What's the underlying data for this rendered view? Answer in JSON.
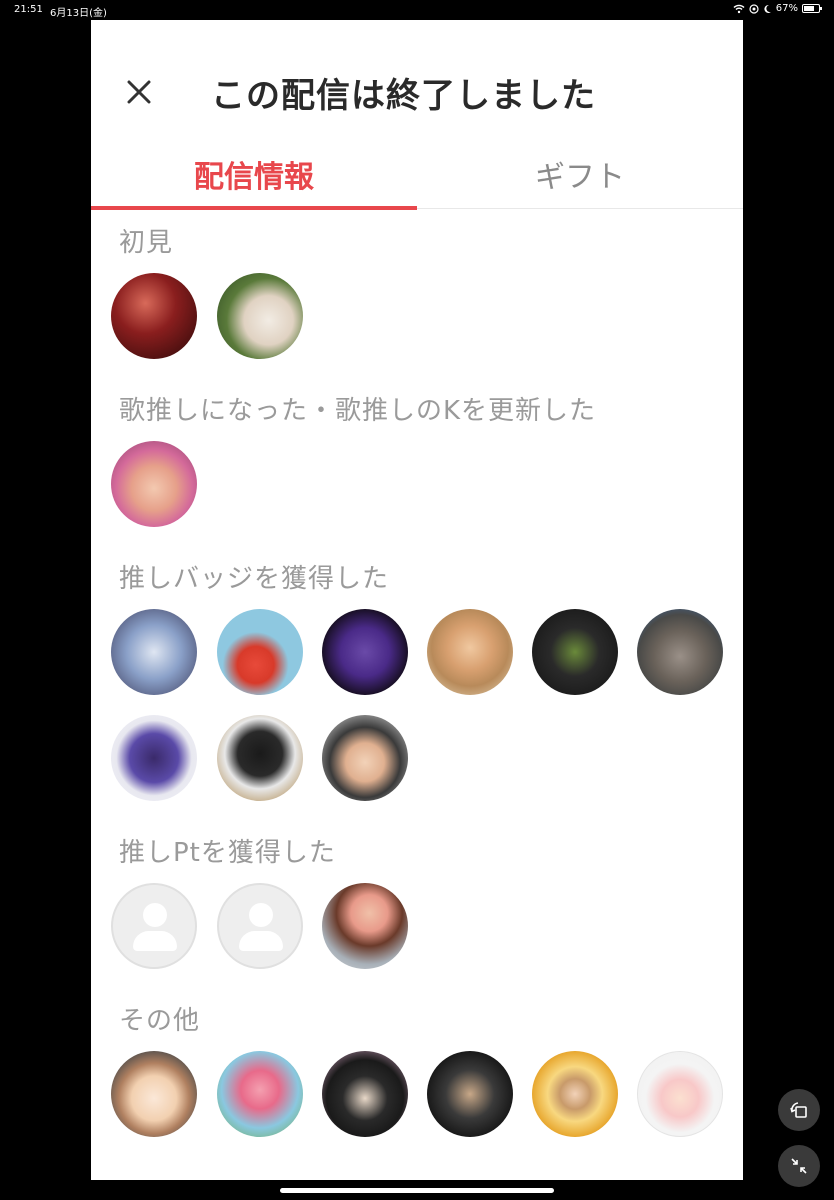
{
  "status_bar": {
    "time": "21:51",
    "date": "6月13日(金)",
    "battery": "67%"
  },
  "header": {
    "title": "この配信は終了しました"
  },
  "tabs": [
    {
      "label": "配信情報",
      "active": true
    },
    {
      "label": "ギフト",
      "active": false
    }
  ],
  "sections": {
    "first_time": {
      "label": "初見"
    },
    "song_oshi": {
      "label": "歌推しになった・歌推しのKを更新した"
    },
    "badge": {
      "label": "推しバッジを獲得した"
    },
    "points": {
      "label": "推しPtを獲得した"
    },
    "other": {
      "label": "その他"
    }
  },
  "icons": {
    "close": "close-icon",
    "default_avatar": "person-icon",
    "rotate": "rotate-icon",
    "collapse": "collapse-icon"
  },
  "colors": {
    "accent": "#e8474c",
    "inactive_tab": "#8a8a8a",
    "section_label": "#9a9a9a"
  }
}
